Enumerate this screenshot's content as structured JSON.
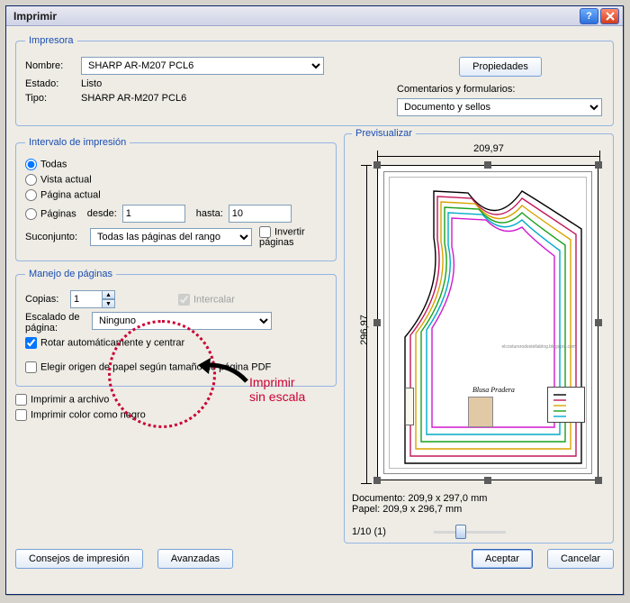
{
  "window": {
    "title": "Imprimir"
  },
  "printer": {
    "legend": "Impresora",
    "name_label": "Nombre:",
    "name_value": "SHARP AR-M207 PCL6",
    "status_label": "Estado:",
    "status_value": "Listo",
    "type_label": "Tipo:",
    "type_value": "SHARP AR-M207 PCL6",
    "properties_btn": "Propiedades",
    "comments_label": "Comentarios y formularios:",
    "comments_value": "Documento y sellos"
  },
  "range": {
    "legend": "Intervalo de impresión",
    "all": "Todas",
    "current_view": "Vista actual",
    "current_page": "Página actual",
    "pages": "Páginas",
    "from": "desde:",
    "from_value": "1",
    "to": "hasta:",
    "to_value": "10",
    "subset_label": "Suconjunto:",
    "subset_value": "Todas las páginas del rango",
    "invert_pages": "Invertir páginas"
  },
  "handling": {
    "legend": "Manejo de páginas",
    "copies_label": "Copias:",
    "copies_value": "1",
    "collate": "Intercalar",
    "scale_label": "Escalado de página:",
    "scale_value": "Ninguno",
    "rotate": "Rotar automáticamente y centrar",
    "origin": "Elegir origen de papel según tamaño de página PDF"
  },
  "options": {
    "to_file": "Imprimir a archivo",
    "color_black": "Imprimir color como negro"
  },
  "preview": {
    "legend": "Previsualizar",
    "width": "209,97",
    "height": "296,97",
    "doc_line": "Documento:  209,9 x 297,0 mm",
    "paper_line": "Papel:  209,9 x 296,7 mm",
    "page_counter": "1/10 (1)",
    "title_text": "Blusa Pradera",
    "credit_text": "elcosturerodestellablog.blogspot.com"
  },
  "buttons": {
    "tips": "Consejos de impresión",
    "advanced": "Avanzadas",
    "ok": "Aceptar",
    "cancel": "Cancelar"
  },
  "annotation": {
    "line1": "Imprimir",
    "line2": "sin escala"
  }
}
